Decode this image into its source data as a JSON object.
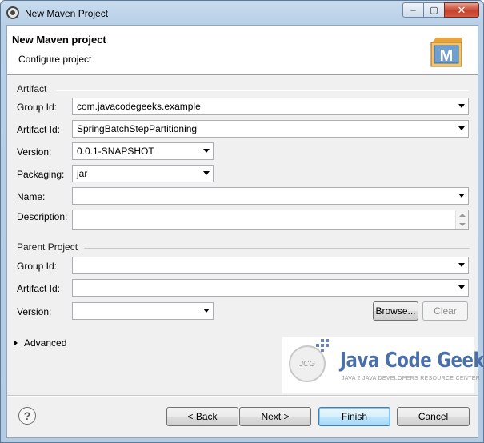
{
  "window": {
    "title": "New Maven Project",
    "controls": {
      "minimize": "–",
      "maximize": "▢",
      "close": "✕"
    }
  },
  "header": {
    "title": "New Maven project",
    "subtitle": "Configure project",
    "logo_letter": "M"
  },
  "artifact": {
    "section_label": "Artifact",
    "group_id": {
      "label": "Group Id:",
      "value": "com.javacodegeeks.example"
    },
    "artifact_id": {
      "label": "Artifact Id:",
      "value": "SpringBatchStepPartitioning"
    },
    "version": {
      "label": "Version:",
      "value": "0.0.1-SNAPSHOT"
    },
    "packaging": {
      "label": "Packaging:",
      "value": "jar"
    },
    "name": {
      "label": "Name:",
      "value": ""
    },
    "description": {
      "label": "Description:",
      "value": ""
    }
  },
  "parent": {
    "section_label": "Parent Project",
    "group_id": {
      "label": "Group Id:",
      "value": ""
    },
    "artifact_id": {
      "label": "Artifact Id:",
      "value": ""
    },
    "version": {
      "label": "Version:",
      "value": ""
    },
    "browse_label": "Browse...",
    "clear_label": "Clear"
  },
  "advanced": {
    "label": "Advanced"
  },
  "branding": {
    "logo_initials": "JCG",
    "name": "Java Code Geeks",
    "tagline": "JAVA 2 JAVA DEVELOPERS RESOURCE CENTER"
  },
  "footer": {
    "help_glyph": "?",
    "back_label": "< Back",
    "next_label": "Next >",
    "finish_label": "Finish",
    "cancel_label": "Cancel"
  }
}
